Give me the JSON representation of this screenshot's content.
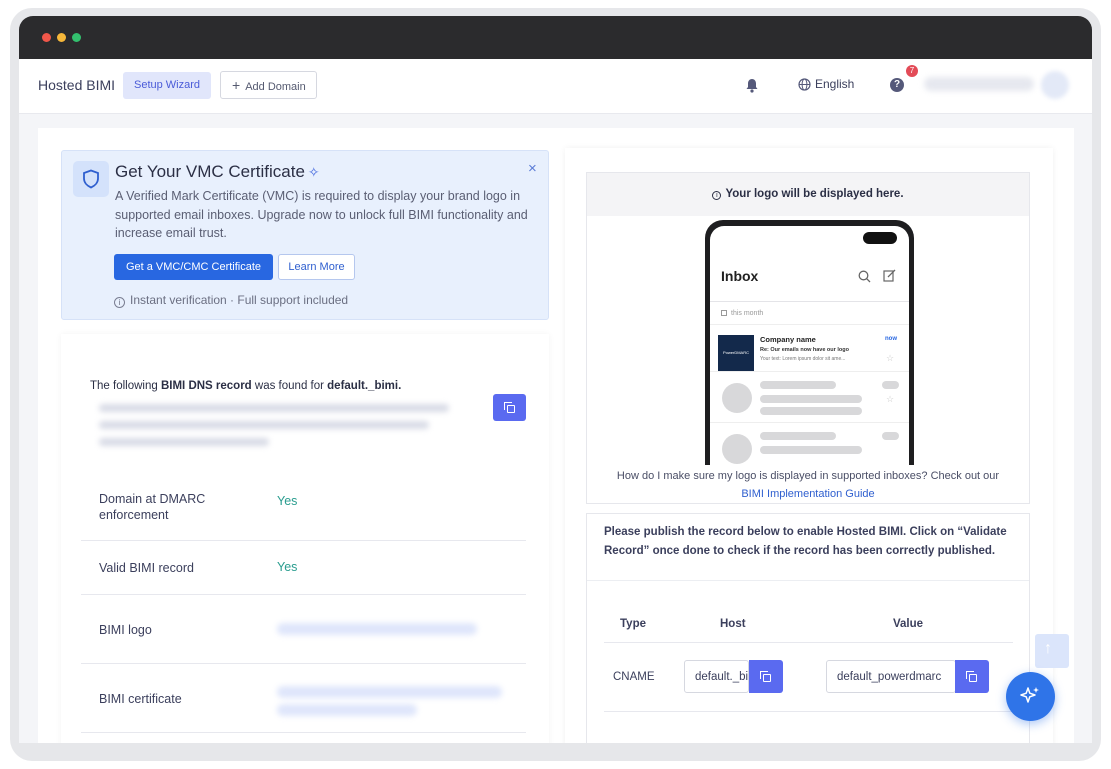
{
  "window": {
    "dot_colors": [
      "#f1574a",
      "#f6b73a",
      "#33c06e"
    ]
  },
  "nav": {
    "brand": "Hosted BIMI",
    "setup_wizard": "Setup Wizard",
    "add_domain": "Add Domain",
    "language": "English",
    "help_label": "?",
    "help_badge": "7"
  },
  "vmc_banner": {
    "title": "Get Your VMC Certificate",
    "description": "A Verified Mark Certificate (VMC) is required to display your brand logo in supported email inboxes. Upgrade now to unlock full BIMI functionality and increase email trust.",
    "primary_button": "Get a VMC/CMC Certificate",
    "secondary_button": "Learn More",
    "note": "Instant verification · Full support included",
    "close": "×"
  },
  "dns_record": {
    "found_prefix": "The following ",
    "found_bold": "BIMI DNS record",
    "found_mid": " was found for ",
    "found_domain": "default._bimi.",
    "checks": [
      {
        "label": "Domain at DMARC enforcement",
        "value": "Yes"
      },
      {
        "label": "Valid BIMI record",
        "value": "Yes"
      },
      {
        "label": "BIMI logo",
        "value": ""
      },
      {
        "label": "BIMI certificate",
        "value": ""
      }
    ]
  },
  "preview": {
    "header": "Your logo will be displayed here.",
    "phone": {
      "title": "Inbox",
      "section": "this month",
      "sender": "Company name",
      "subject": "Re: Our emails now have our logo",
      "snippet": "Your text: Lorem ipsum dolor sit ame...",
      "time": "now",
      "logo_text": "PowerDMARC"
    },
    "footer_text": "How do I make sure my logo is displayed in supported inboxes? Check out our",
    "footer_link": "BIMI Implementation Guide"
  },
  "publish": {
    "instructions": "Please publish the record below to enable Hosted BIMI. Click on “Validate Record” once done to check if the record has been correctly published.",
    "columns": [
      "Type",
      "Host",
      "Value"
    ],
    "row": {
      "type": "CNAME",
      "host": "default._bimi",
      "value": "default_powerdmarc"
    }
  }
}
